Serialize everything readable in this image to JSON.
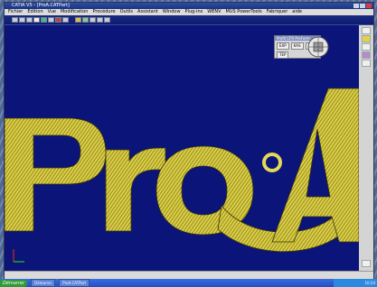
{
  "window": {
    "title": "CATIA V5 - [ProA.CATPart]"
  },
  "menu": [
    "Fichier",
    "Édition",
    "Vue",
    "Modification",
    "Procédure",
    "Outils",
    "Assistant",
    "Window",
    "Plug-ins",
    "WENV",
    "MUS PowerTools",
    "Fabriquer",
    "aide"
  ],
  "panel": {
    "title": "Profil CFR ProForm",
    "buttons": [
      "EXP",
      "KAS",
      "2KX",
      "TEP"
    ]
  },
  "viewport": {
    "text": "ProA",
    "background": "#0b1478",
    "engrave_color": "#b8ad2e"
  },
  "taskbar": {
    "start_label": "Démarrer",
    "tasks": [
      "Démarrer",
      "ProA.CATPart"
    ],
    "clock": "10:24"
  }
}
